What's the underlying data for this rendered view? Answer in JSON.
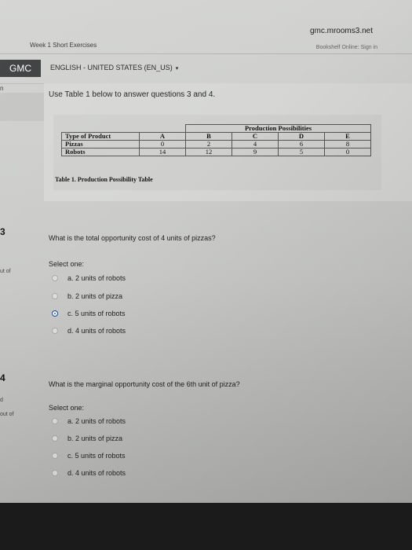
{
  "browser": {
    "url": "gmc.mrooms3.net"
  },
  "topbar": {
    "week": "Week 1 Short Exercises",
    "right": "Bookshelf Online: Sign in"
  },
  "header": {
    "logo": "GMC",
    "language": "ENGLISH - UNITED STATES (EN_US)",
    "caret": "▾"
  },
  "side": {
    "n": "n",
    "q3_num": "3",
    "q3_side": "ut of",
    "q4_num": "4",
    "q4_mark": "d",
    "q4_side": "out of"
  },
  "intro": "Use Table 1 below to answer questions 3 and 4.",
  "table": {
    "group_header": "Production Possibilities",
    "columns": [
      "A",
      "B",
      "C",
      "D",
      "E"
    ],
    "rows": [
      {
        "label": "Type of Product",
        "values": [
          "A",
          "B",
          "C",
          "D",
          "E"
        ]
      },
      {
        "label": "Pizzas",
        "values": [
          "0",
          "2",
          "4",
          "6",
          "8"
        ]
      },
      {
        "label": "Robots",
        "values": [
          "14",
          "12",
          "9",
          "5",
          "0"
        ]
      }
    ],
    "caption": "Table 1. Production Possibility Table"
  },
  "q3": {
    "text": "What is the total opportunity cost of 4 units of pizzas?",
    "select": "Select one:",
    "options": [
      "a. 2 units of robots",
      "b. 2 units of pizza",
      "c. 5 units of robots",
      "d. 4 units of robots"
    ],
    "selected": "c"
  },
  "q4": {
    "text": "What is the marginal opportunity cost of the 6th unit of pizza?",
    "select": "Select one:",
    "options": [
      "a. 2 units of robots",
      "b. 2 units of pizza",
      "c. 5 units of robots",
      "d. 4 units of robots"
    ],
    "selected": ""
  },
  "colors": {
    "radio_selected": "#2e6bd1",
    "logo_bg": "#38393a"
  }
}
